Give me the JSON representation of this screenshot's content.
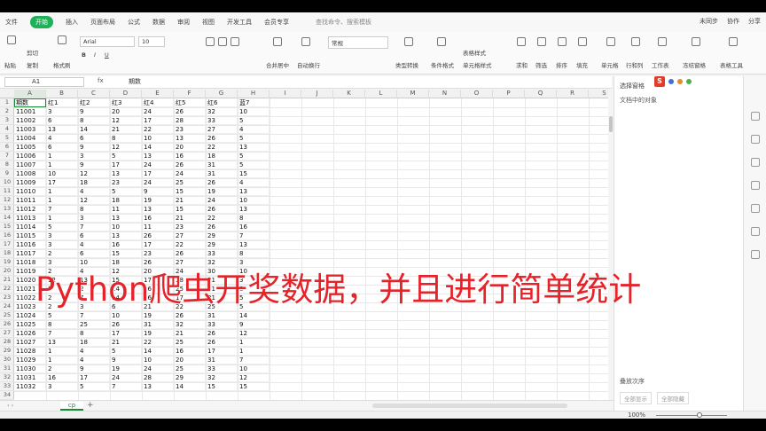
{
  "topbar": {
    "menu": [
      "文件",
      "开始",
      "插入",
      "页面布局",
      "公式",
      "数据",
      "审阅",
      "视图",
      "开发工具",
      "会员专享"
    ],
    "active": "开始",
    "search": "查找命令、搜索模板",
    "right": [
      "未同步",
      "协作",
      "分享"
    ]
  },
  "ribbon": {
    "paste": "粘贴",
    "cut": "剪切",
    "copy": "复制",
    "format_painter": "格式刷",
    "font_name": "Arial",
    "font_size": "10",
    "merge": "合并居中",
    "wrap": "自动换行",
    "number_format": "常规",
    "type_convert": "类型转换",
    "conditional": "条件格式",
    "table_style": "表格样式",
    "cell_style": "单元格样式",
    "sum": "求和",
    "filter": "筛选",
    "sort": "排序",
    "fill": "填充",
    "cell": "单元格",
    "rowcol": "行和列",
    "worksheet": "工作表",
    "freeze": "冻结窗格",
    "table_tools": "表格工具"
  },
  "formula": {
    "cell_ref": "A1",
    "fx": "fx",
    "value": "期数"
  },
  "columns": [
    "A",
    "B",
    "C",
    "D",
    "E",
    "F",
    "G",
    "H",
    "I",
    "J",
    "K",
    "L",
    "M",
    "N",
    "O",
    "P",
    "Q",
    "R",
    "S"
  ],
  "headers": [
    "期数",
    "红1",
    "红2",
    "红3",
    "红4",
    "红5",
    "红6",
    "蓝7"
  ],
  "rows": [
    [
      "11001",
      "3",
      "9",
      "20",
      "24",
      "26",
      "32",
      "10"
    ],
    [
      "11002",
      "6",
      "8",
      "12",
      "17",
      "28",
      "33",
      "5"
    ],
    [
      "11003",
      "13",
      "14",
      "21",
      "22",
      "23",
      "27",
      "4"
    ],
    [
      "11004",
      "4",
      "6",
      "8",
      "10",
      "13",
      "26",
      "5"
    ],
    [
      "11005",
      "6",
      "9",
      "12",
      "14",
      "20",
      "22",
      "13"
    ],
    [
      "11006",
      "1",
      "3",
      "5",
      "13",
      "16",
      "18",
      "5"
    ],
    [
      "11007",
      "1",
      "9",
      "17",
      "24",
      "26",
      "31",
      "5"
    ],
    [
      "11008",
      "10",
      "12",
      "13",
      "17",
      "24",
      "31",
      "15"
    ],
    [
      "11009",
      "17",
      "18",
      "23",
      "24",
      "25",
      "26",
      "4"
    ],
    [
      "11010",
      "1",
      "4",
      "5",
      "9",
      "15",
      "19",
      "13"
    ],
    [
      "11011",
      "1",
      "12",
      "18",
      "19",
      "21",
      "24",
      "10"
    ],
    [
      "11012",
      "7",
      "8",
      "11",
      "13",
      "15",
      "26",
      "13"
    ],
    [
      "11013",
      "1",
      "3",
      "13",
      "16",
      "21",
      "22",
      "8"
    ],
    [
      "11014",
      "5",
      "7",
      "10",
      "11",
      "23",
      "26",
      "16"
    ],
    [
      "11015",
      "3",
      "6",
      "13",
      "26",
      "27",
      "29",
      "7"
    ],
    [
      "11016",
      "3",
      "4",
      "16",
      "17",
      "22",
      "29",
      "13"
    ],
    [
      "11017",
      "2",
      "6",
      "15",
      "23",
      "26",
      "33",
      "8"
    ],
    [
      "11018",
      "3",
      "10",
      "18",
      "26",
      "27",
      "32",
      "3"
    ],
    [
      "11019",
      "2",
      "4",
      "12",
      "20",
      "24",
      "30",
      "10"
    ],
    [
      "11020",
      "12",
      "13",
      "15",
      "17",
      "18",
      "31",
      "3"
    ],
    [
      "11021",
      "1",
      "2",
      "14",
      "16",
      "25",
      "31",
      "8"
    ],
    [
      "11022",
      "2",
      "7",
      "14",
      "16",
      "17",
      "21",
      "5"
    ],
    [
      "11023",
      "2",
      "3",
      "6",
      "21",
      "22",
      "25",
      "5"
    ],
    [
      "11024",
      "5",
      "7",
      "10",
      "19",
      "26",
      "31",
      "14"
    ],
    [
      "11025",
      "8",
      "25",
      "26",
      "31",
      "32",
      "33",
      "9"
    ],
    [
      "11026",
      "7",
      "8",
      "17",
      "19",
      "21",
      "26",
      "12"
    ],
    [
      "11027",
      "13",
      "18",
      "21",
      "22",
      "25",
      "26",
      "1"
    ],
    [
      "11028",
      "1",
      "4",
      "5",
      "14",
      "16",
      "17",
      "1"
    ],
    [
      "11029",
      "1",
      "4",
      "9",
      "10",
      "20",
      "31",
      "7"
    ],
    [
      "11030",
      "2",
      "9",
      "19",
      "24",
      "25",
      "33",
      "10"
    ],
    [
      "11031",
      "16",
      "17",
      "24",
      "28",
      "29",
      "32",
      "12"
    ],
    [
      "11032",
      "3",
      "5",
      "7",
      "13",
      "14",
      "15",
      "15"
    ]
  ],
  "sheet": {
    "tab": "cp",
    "add": "+"
  },
  "side": {
    "title": "选择窗格",
    "sub": "文档中的对象",
    "order": "叠放次序",
    "show_all": "全部显示",
    "hide_all": "全部隐藏"
  },
  "status": {
    "zoom": "100%"
  },
  "overlay": "Python爬虫开奖数据，并且进行简单统计"
}
